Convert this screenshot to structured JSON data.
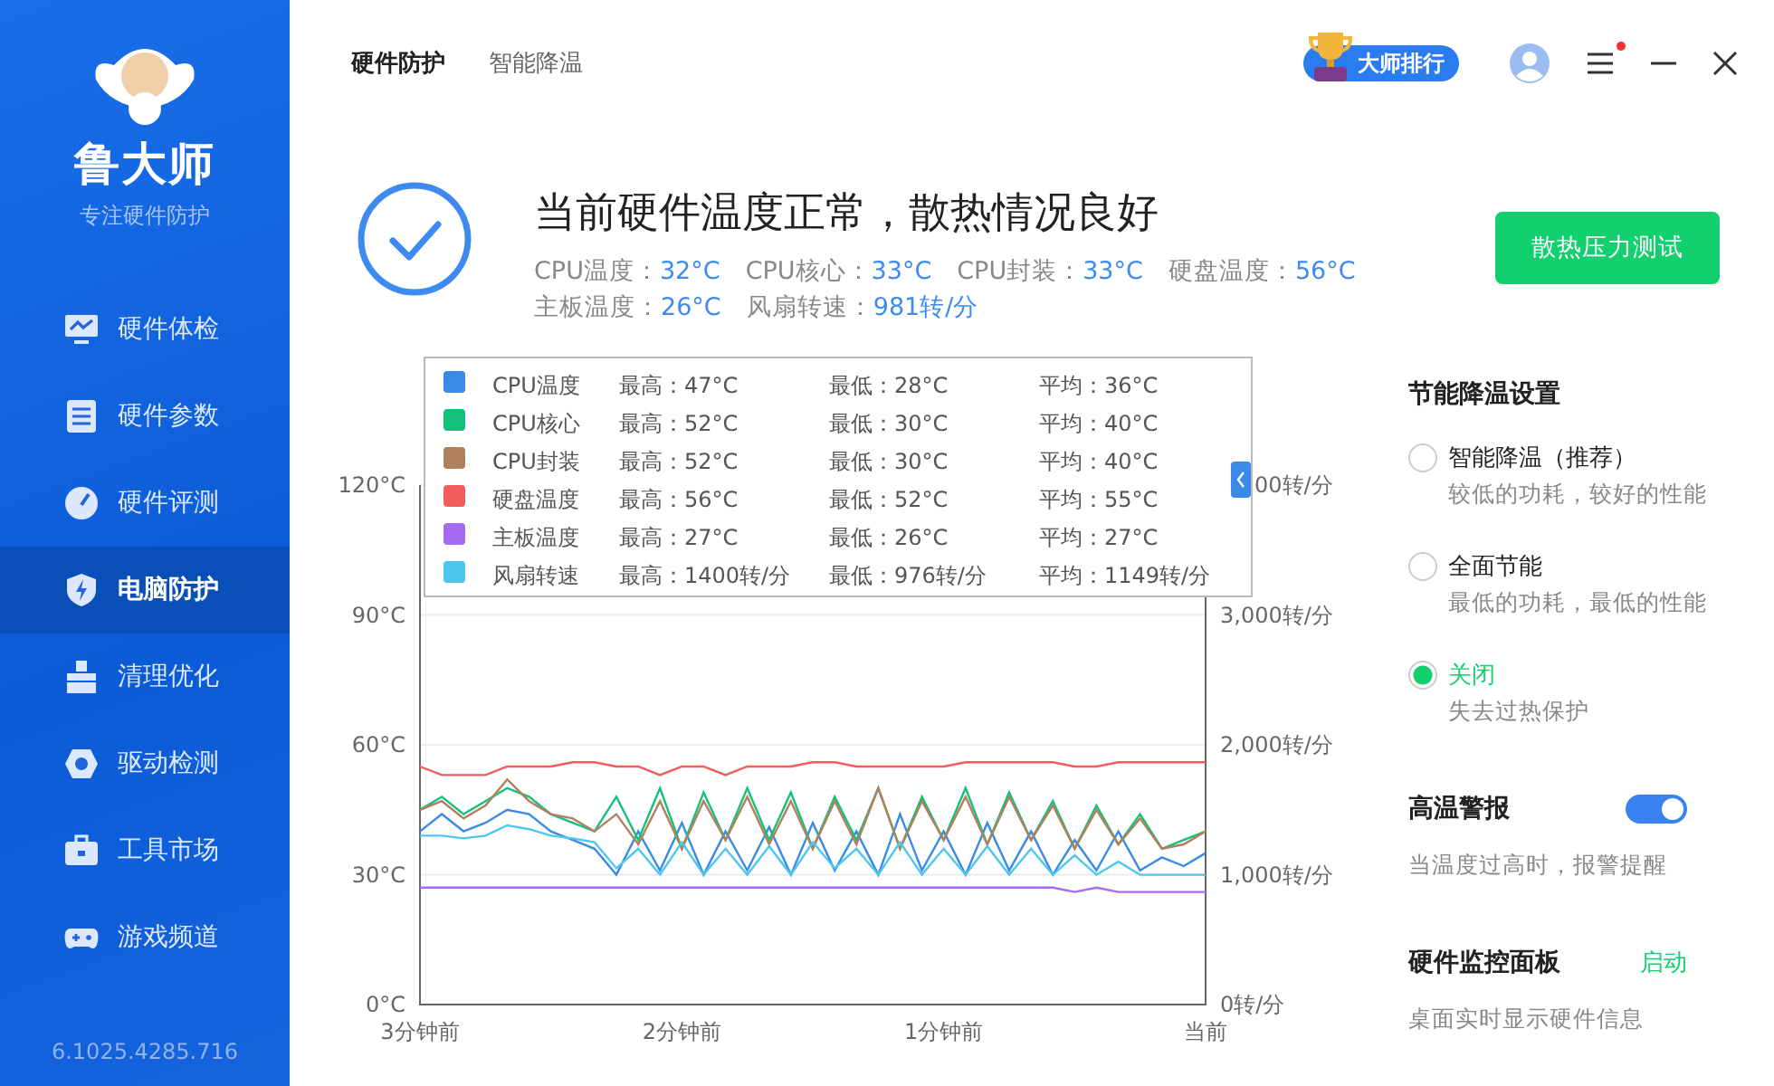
{
  "sidebar": {
    "logo_text": "鲁大师",
    "tagline": "专注硬件防护",
    "items": [
      {
        "label": "硬件体检",
        "selected": false
      },
      {
        "label": "硬件参数",
        "selected": false
      },
      {
        "label": "硬件评测",
        "selected": false
      },
      {
        "label": "电脑防护",
        "selected": true
      },
      {
        "label": "清理优化",
        "selected": false
      },
      {
        "label": "驱动检测",
        "selected": false
      },
      {
        "label": "工具市场",
        "selected": false
      },
      {
        "label": "游戏频道",
        "selected": false
      }
    ],
    "version": "6.1025.4285.716"
  },
  "header": {
    "tabs": [
      {
        "label": "硬件防护",
        "selected": true
      },
      {
        "label": "智能降温",
        "selected": false
      }
    ],
    "rank_badge": "大师排行",
    "menu_notification": true
  },
  "status": {
    "title": "当前硬件温度正常，散热情况良好",
    "readings": [
      {
        "label": "CPU温度：",
        "value": "32°C"
      },
      {
        "label": "CPU核心：",
        "value": "33°C"
      },
      {
        "label": "CPU封装：",
        "value": "33°C"
      },
      {
        "label": "硬盘温度：",
        "value": "56°C"
      },
      {
        "label": "主板温度：",
        "value": "26°C"
      },
      {
        "label": "风扇转速：",
        "value": "981转/分"
      }
    ],
    "button": "散热压力测试"
  },
  "chart": {
    "chart_data": {
      "type": "line",
      "categories": [
        "3分钟前",
        null,
        null,
        null,
        null,
        null,
        null,
        null,
        null,
        null,
        null,
        null,
        "2分钟前",
        null,
        null,
        null,
        null,
        null,
        null,
        null,
        null,
        null,
        null,
        null,
        "1分钟前",
        null,
        null,
        null,
        null,
        null,
        null,
        null,
        null,
        null,
        null,
        null,
        "当前"
      ],
      "ylim": [
        0,
        120
      ],
      "yticks": [
        {
          "value": 0,
          "label": "0°C"
        },
        {
          "value": 30,
          "label": "30°C"
        },
        {
          "value": 60,
          "label": "60°C"
        },
        {
          "value": 90,
          "label": "90°C"
        },
        {
          "value": 120,
          "label": "120°C"
        }
      ],
      "y2lim": [
        0,
        4000
      ],
      "y2ticks": [
        {
          "value": 0,
          "label": "0转/分"
        },
        {
          "value": 1000,
          "label": "1,000转/分"
        },
        {
          "value": 2000,
          "label": "2,000转/分"
        },
        {
          "value": 3000,
          "label": "3,000转/分"
        }
      ],
      "grid": true,
      "legend": "top",
      "series": [
        {
          "name": "CPU温度",
          "color": "#3a8ae8",
          "values": [
            40,
            44,
            40,
            42,
            45,
            44,
            40,
            38,
            36,
            30,
            40,
            31,
            42,
            30,
            40,
            31,
            41,
            30,
            42,
            31,
            40,
            30,
            44,
            31,
            40,
            30,
            42,
            31,
            40,
            30,
            38,
            31,
            40,
            31,
            34,
            32,
            35
          ]
        },
        {
          "name": "CPU核心",
          "color": "#14c17a",
          "values": [
            45,
            48,
            44,
            47,
            50,
            48,
            44,
            42,
            40,
            48,
            38,
            50,
            36,
            49,
            38,
            50,
            38,
            49,
            36,
            48,
            38,
            50,
            36,
            48,
            38,
            50,
            37,
            49,
            38,
            47,
            36,
            46,
            37,
            44,
            36,
            38,
            40
          ]
        },
        {
          "name": "CPU封装",
          "color": "#b3805e",
          "values": [
            45,
            47,
            43,
            46,
            52,
            47,
            44,
            43,
            40,
            44,
            37,
            47,
            36,
            47,
            38,
            48,
            37,
            47,
            36,
            47,
            37,
            50,
            36,
            47,
            38,
            48,
            37,
            48,
            38,
            46,
            36,
            45,
            37,
            43,
            36,
            37,
            40
          ]
        },
        {
          "name": "硬盘温度",
          "color": "#f25c5c",
          "values": [
            55,
            53,
            53,
            53,
            55,
            55,
            55,
            56,
            56,
            55,
            55,
            53,
            55,
            55,
            53,
            55,
            55,
            55,
            56,
            56,
            55,
            55,
            55,
            55,
            55,
            56,
            56,
            56,
            56,
            56,
            55,
            55,
            56,
            56,
            56,
            56,
            56
          ]
        },
        {
          "name": "主板温度",
          "color": "#a46cf0",
          "values": [
            27,
            27,
            27,
            27,
            27,
            27,
            27,
            27,
            27,
            27,
            27,
            27,
            27,
            27,
            27,
            27,
            27,
            27,
            27,
            27,
            27,
            27,
            27,
            27,
            27,
            27,
            27,
            27,
            27,
            27,
            26,
            27,
            26,
            26,
            26,
            26,
            26
          ]
        },
        {
          "name": "风扇转速",
          "color": "#4cc8f0",
          "axis": "y2",
          "values": [
            1300,
            1300,
            1280,
            1300,
            1380,
            1350,
            1300,
            1280,
            1250,
            1050,
            1200,
            1000,
            1250,
            1000,
            1200,
            1000,
            1220,
            1000,
            1250,
            1050,
            1200,
            1000,
            1250,
            1000,
            1200,
            1000,
            1220,
            1000,
            1200,
            1000,
            1150,
            1000,
            1100,
            1000,
            1000,
            1000,
            1000
          ]
        }
      ]
    },
    "cut_axis_label": "00转/分",
    "legend": [
      {
        "max": "最高：47°C",
        "min": "最低：28°C",
        "avg": "平均：36°C"
      },
      {
        "max": "最高：52°C",
        "min": "最低：30°C",
        "avg": "平均：40°C"
      },
      {
        "max": "最高：52°C",
        "min": "最低：30°C",
        "avg": "平均：40°C"
      },
      {
        "max": "最高：56°C",
        "min": "最低：52°C",
        "avg": "平均：55°C"
      },
      {
        "max": "最高：27°C",
        "min": "最低：26°C",
        "avg": "平均：27°C"
      },
      {
        "max": "最高：1400转/分",
        "min": "最低：976转/分",
        "avg": "平均：1149转/分"
      }
    ]
  },
  "settings": {
    "title": "节能降温设置",
    "options": [
      {
        "label": "智能降温（推荐）",
        "desc": "较低的功耗，较好的性能",
        "selected": false
      },
      {
        "label": "全面节能",
        "desc": "最低的功耗，最低的性能",
        "selected": false
      },
      {
        "label": "关闭",
        "desc": "失去过热保护",
        "selected": true
      }
    ],
    "alert": {
      "title": "高温警报",
      "desc": "当温度过高时，报警提醒",
      "on": true
    },
    "monitor": {
      "title": "硬件监控面板",
      "action": "启动",
      "desc": "桌面实时显示硬件信息"
    }
  }
}
